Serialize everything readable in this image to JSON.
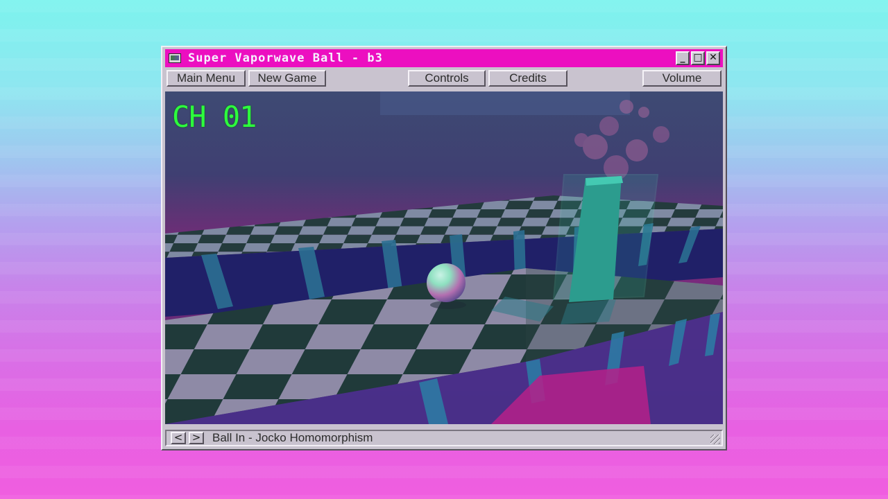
{
  "window": {
    "title": "Super Vaporwave Ball - b3",
    "controls": {
      "minimize": "_",
      "maximize": "□",
      "close": "✕"
    }
  },
  "menu": {
    "main_menu": "Main Menu",
    "new_game": "New Game",
    "controls": "Controls",
    "credits": "Credits",
    "volume": "Volume"
  },
  "game": {
    "chapter": "CH 01"
  },
  "status": {
    "prev": "<",
    "next": ">",
    "now_playing": "Ball In - Jocko Homomorphism"
  },
  "colors": {
    "title_bar": "#ec0fc0",
    "chapter_text": "#2dff3d",
    "window_face": "#c9c3cf"
  }
}
